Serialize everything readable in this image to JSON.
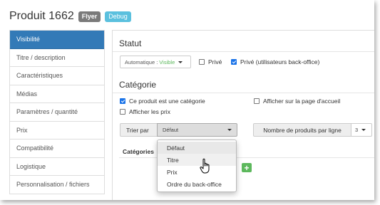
{
  "header": {
    "title": "Produit 1662",
    "badge_flyer": "Flyer",
    "badge_debug": "Debug"
  },
  "sidebar": {
    "items": [
      {
        "label": "Visibilité",
        "active": true
      },
      {
        "label": "Titre / description"
      },
      {
        "label": "Caractéristiques"
      },
      {
        "label": "Médias"
      },
      {
        "label": "Paramètres / quantité"
      },
      {
        "label": "Prix"
      },
      {
        "label": "Compatibilité"
      },
      {
        "label": "Logistique"
      },
      {
        "label": "Personnalisation / fichiers"
      }
    ]
  },
  "statut": {
    "title": "Statut",
    "select_prefix": "Automatique :",
    "select_value": "Visible",
    "prive_label": "Privé",
    "prive_checked": false,
    "prive_bo_label": "Privé (utilisateurs back-office)",
    "prive_bo_checked": true
  },
  "categorie": {
    "title": "Catégorie",
    "is_category_label": "Ce produit est une catégorie",
    "is_category_checked": true,
    "homepage_label": "Afficher sur la page d'accueil",
    "homepage_checked": false,
    "show_prices_label": "Afficher les prix",
    "show_prices_checked": false,
    "sort_label": "Trier par",
    "sort_value": "Défaut",
    "per_line_label": "Nombre de produits par ligne",
    "per_line_value": "3",
    "tab_categories": "Catégories"
  },
  "dropdown": {
    "options": [
      "Défaut",
      "Titre",
      "Prix",
      "Ordre du back-office"
    ],
    "selected": "Défaut",
    "hovered": "Titre"
  },
  "colors": {
    "accent": "#337ab7",
    "visible_green": "#5cb85c",
    "debug_badge": "#5bc0de",
    "flyer_badge": "#7a7a7a"
  }
}
